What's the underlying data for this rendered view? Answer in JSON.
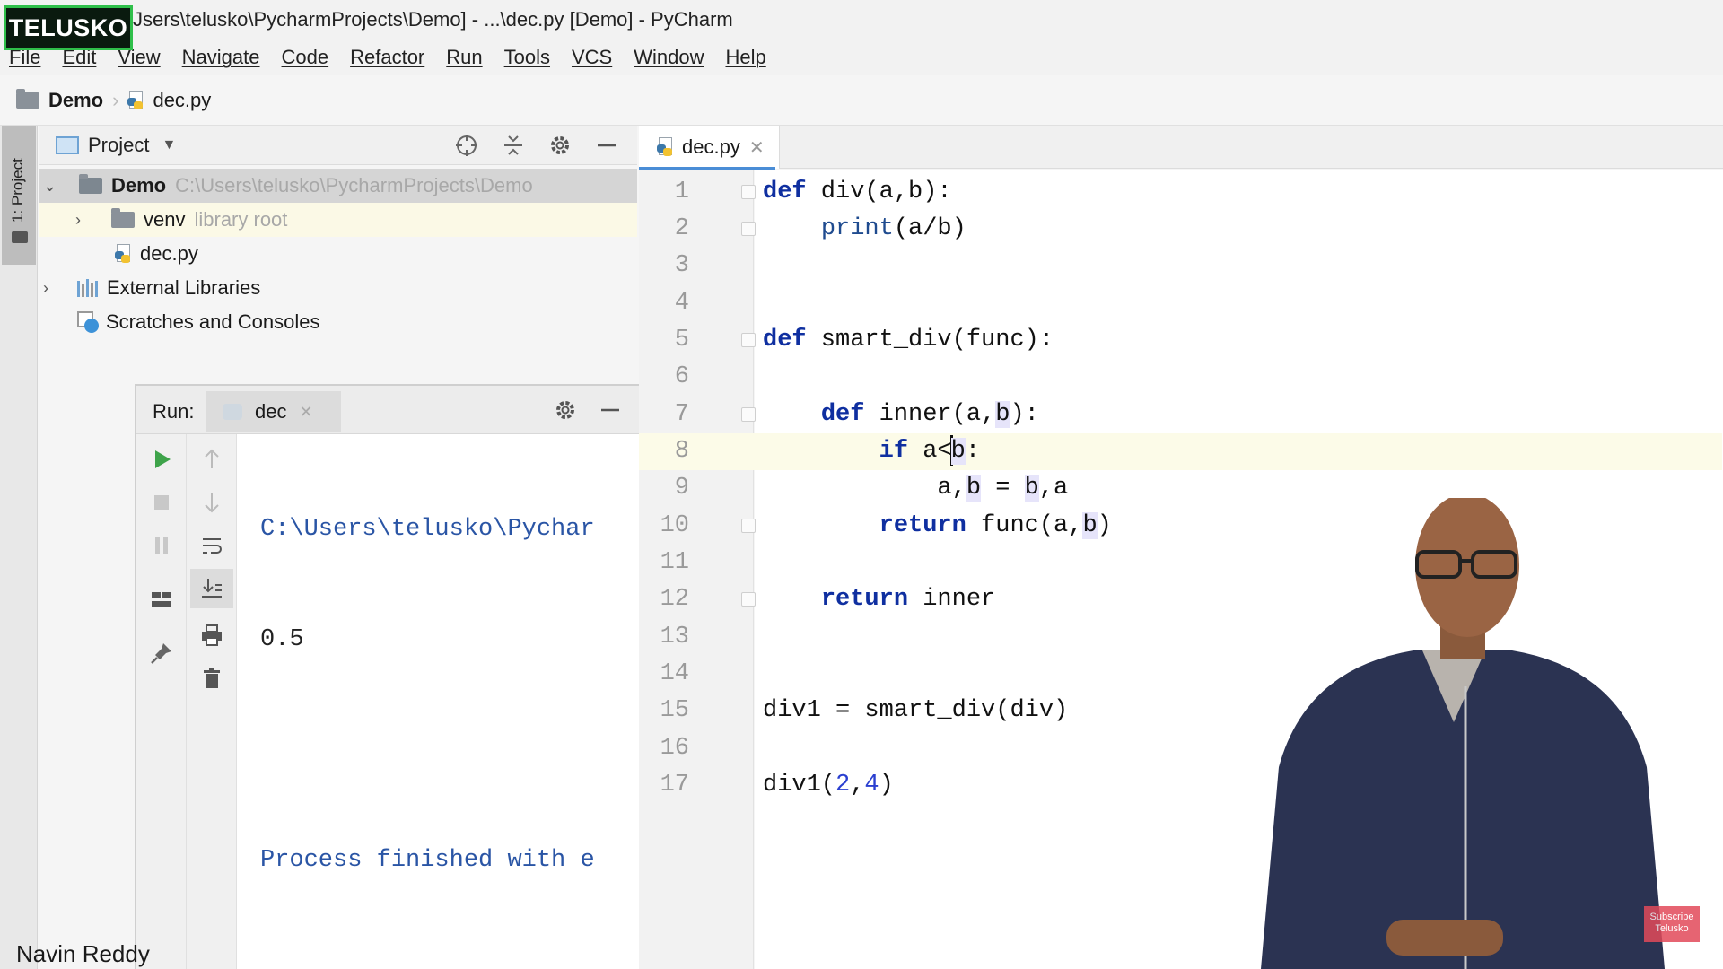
{
  "brand": "TELUSKO",
  "window_title": "Jsers\\telusko\\PycharmProjects\\Demo] - ...\\dec.py [Demo] - PyCharm",
  "menu": [
    "File",
    "Edit",
    "View",
    "Navigate",
    "Code",
    "Refactor",
    "Run",
    "Tools",
    "VCS",
    "Window",
    "Help"
  ],
  "breadcrumb": {
    "project": "Demo",
    "file": "dec.py"
  },
  "tool_strip": {
    "project_tab": "1: Project"
  },
  "project_panel": {
    "title": "Project",
    "tree": [
      {
        "label": "Demo",
        "path": "C:\\Users\\telusko\\PycharmProjects\\Demo"
      },
      {
        "label": "venv",
        "note": "library root"
      },
      {
        "label": "dec.py"
      },
      {
        "label": "External Libraries"
      },
      {
        "label": "Scratches and Consoles"
      }
    ]
  },
  "run_panel": {
    "label": "Run:",
    "tab": "dec",
    "console": [
      "C:\\Users\\telusko\\Pychar",
      "0.5",
      "",
      "Process finished with e"
    ]
  },
  "editor": {
    "tab": "dec.py",
    "line_numbers": [
      "1",
      "2",
      "3",
      "4",
      "5",
      "6",
      "7",
      "8",
      "9",
      "10",
      "11",
      "12",
      "13",
      "14",
      "15",
      "16",
      "17"
    ]
  },
  "caption": {
    "name": "Navin Reddy",
    "subscribe": "Subscribe Telusko"
  },
  "colors": {
    "keyword": "#0f2fa0",
    "builtin": "#1f4b8f",
    "number": "#2a3fd0",
    "brand_border": "#2fbf4a",
    "console_blue": "#2a55a5"
  }
}
